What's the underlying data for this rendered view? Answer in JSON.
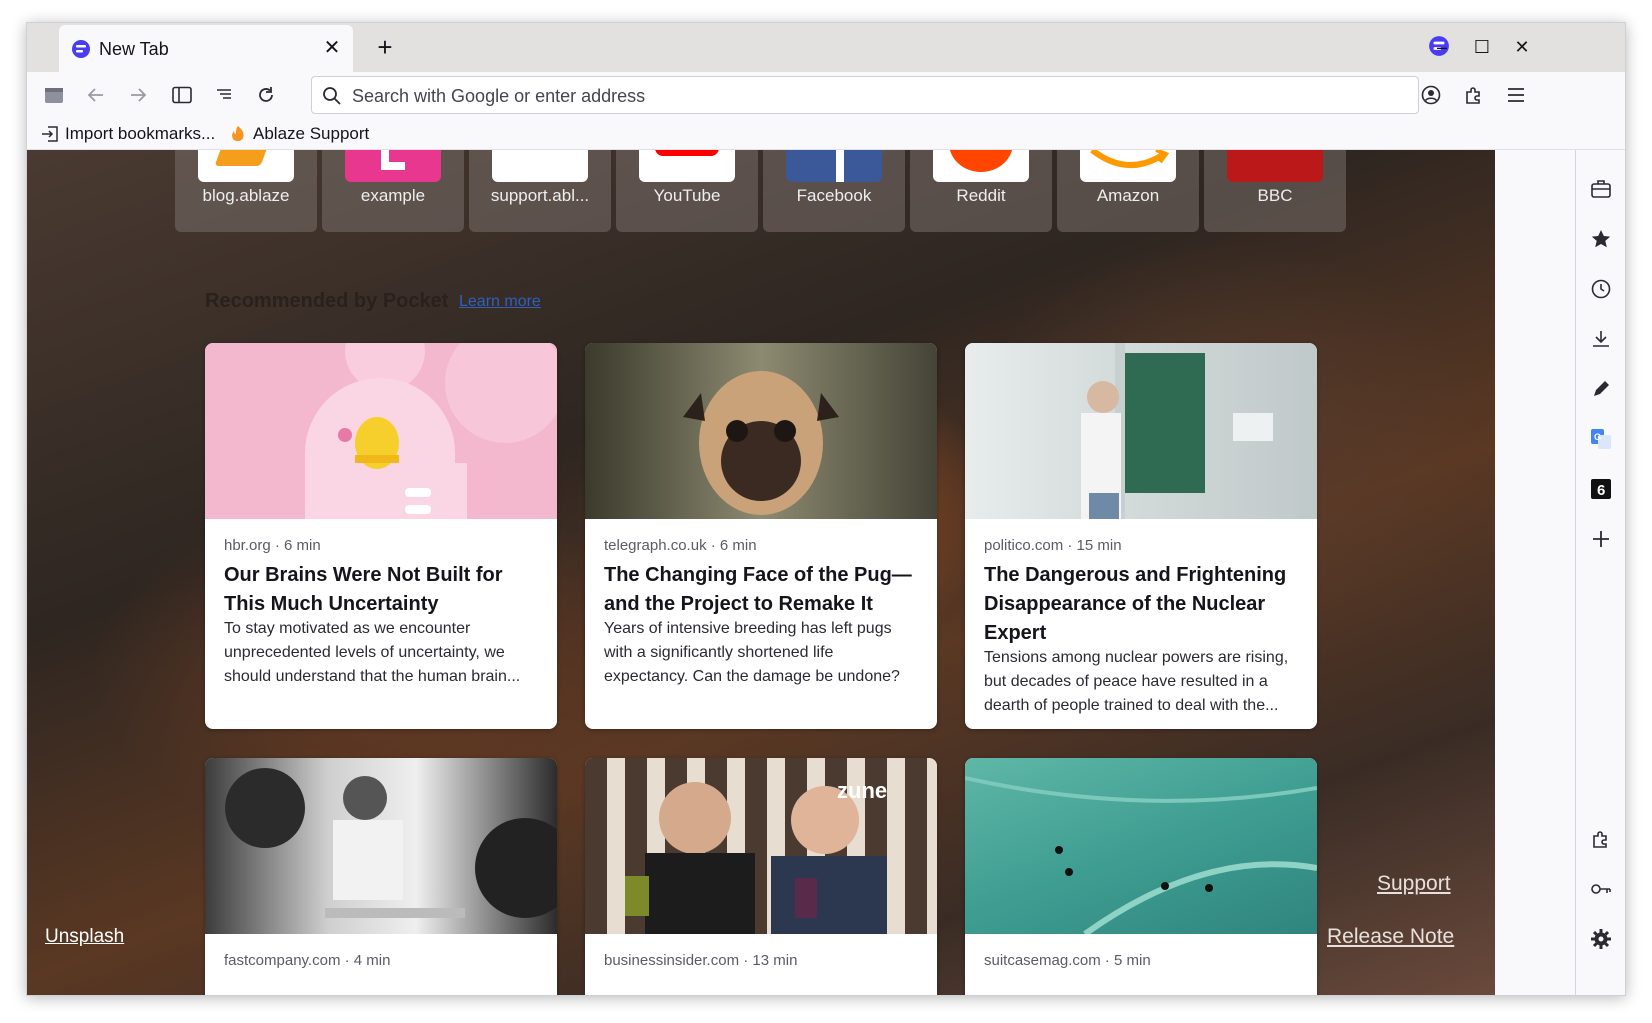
{
  "browser": {
    "tab": {
      "title": "New Tab"
    },
    "search": {
      "placeholder": "Search with Google or enter address"
    },
    "bookmarks": [
      {
        "label": "Import bookmarks...",
        "icon": "import-icon"
      },
      {
        "label": "Ablaze Support",
        "icon": "ablaze-flame-icon"
      }
    ]
  },
  "top_sites": [
    {
      "label": "blog.ablaze",
      "color": "#f59e1b"
    },
    {
      "label": "example",
      "color": "#e8378f"
    },
    {
      "label": "support.abl...",
      "color": "#ffffff"
    },
    {
      "label": "YouTube",
      "color": "#ff0000"
    },
    {
      "label": "Facebook",
      "color": "#3b5998"
    },
    {
      "label": "Reddit",
      "color": "#ff4500"
    },
    {
      "label": "Amazon",
      "color": "#ff9900"
    },
    {
      "label": "BBC",
      "color": "#bb1919"
    }
  ],
  "pocket": {
    "heading": "Recommended by Pocket",
    "learn_more": "Learn more",
    "stories": [
      {
        "source": "hbr.org · 6 min",
        "title": "Our Brains Were Not Built for This Much Uncertainty",
        "excerpt": "To stay motivated as we encounter unprecedented levels of uncertainty, we should understand that the human brain..."
      },
      {
        "source": "telegraph.co.uk · 6 min",
        "title": "The Changing Face of the Pug—and the Project to Remake It",
        "excerpt": "Years of intensive breeding has left pugs with a significantly shortened life expectancy. Can the damage be undone?"
      },
      {
        "source": "politico.com · 15 min",
        "title": "The Dangerous and Frightening Disappearance of the Nuclear Expert",
        "excerpt": "Tensions among nuclear powers are rising, but decades of peace have resulted in a dearth of people trained to deal with the..."
      },
      {
        "source": "fastcompany.com · 4 min"
      },
      {
        "source": "businessinsider.com · 13 min"
      },
      {
        "source": "suitcasemag.com · 5 min"
      }
    ]
  },
  "footer": {
    "unsplash": "Unsplash",
    "support": "Support",
    "release_note": "Release Note"
  }
}
